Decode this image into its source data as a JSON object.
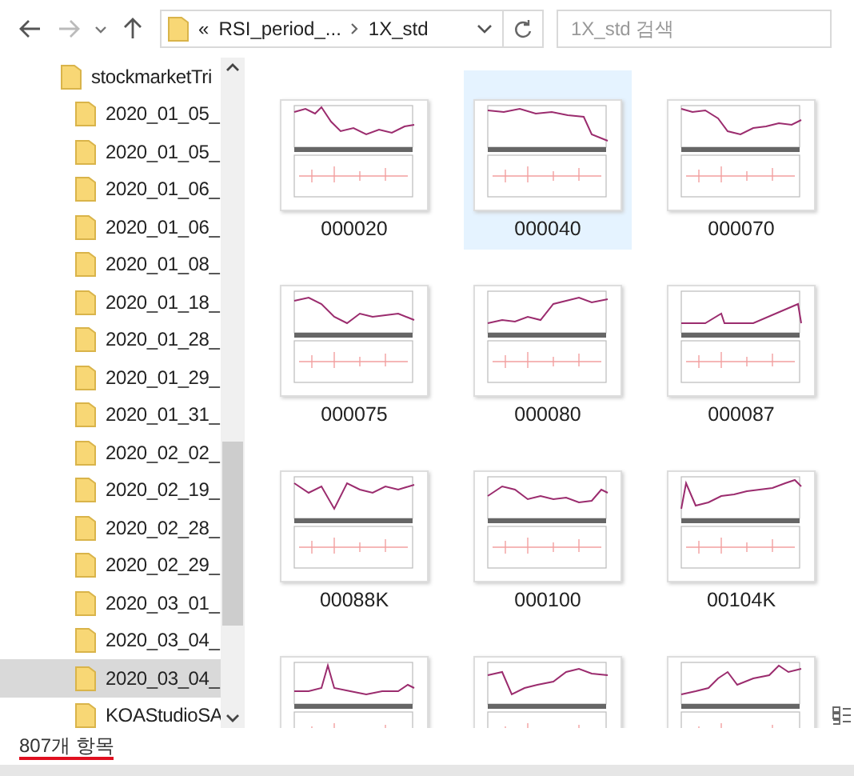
{
  "toolbar": {
    "path": [
      "RSI_period_...",
      "1X_std"
    ],
    "path_prefix": "«",
    "search": {
      "placeholder": "1X_std 검색"
    }
  },
  "navigation": {
    "items": [
      {
        "label": "stockmarketTri",
        "selected": false,
        "children": [
          {
            "label": "2020_01_05_",
            "selected": false
          },
          {
            "label": "2020_01_05_",
            "selected": false
          },
          {
            "label": "2020_01_06_",
            "selected": false
          },
          {
            "label": "2020_01_06_",
            "selected": false
          },
          {
            "label": "2020_01_08_",
            "selected": false
          },
          {
            "label": "2020_01_18_",
            "selected": false
          },
          {
            "label": "2020_01_28_",
            "selected": false
          },
          {
            "label": "2020_01_29_",
            "selected": false
          },
          {
            "label": "2020_01_31_",
            "selected": false
          },
          {
            "label": "2020_02_02_",
            "selected": false
          },
          {
            "label": "2020_02_19_",
            "selected": false
          },
          {
            "label": "2020_02_28_",
            "selected": false
          },
          {
            "label": "2020_02_29_",
            "selected": false
          },
          {
            "label": "2020_03_01_",
            "selected": false
          },
          {
            "label": "2020_03_04_",
            "selected": false
          },
          {
            "label": "2020_03_04_",
            "selected": true
          },
          {
            "label": "KOAStudioSA",
            "selected": false
          }
        ]
      }
    ]
  },
  "files": [
    {
      "label": "000020",
      "selected": false
    },
    {
      "label": "000040",
      "selected": true
    },
    {
      "label": "000070",
      "selected": false
    },
    {
      "label": "000075",
      "selected": false
    },
    {
      "label": "000080",
      "selected": false
    },
    {
      "label": "000087",
      "selected": false
    },
    {
      "label": "00088K",
      "selected": false
    },
    {
      "label": "000100",
      "selected": false
    },
    {
      "label": "00104K",
      "selected": false
    },
    {
      "selected": false
    },
    {
      "selected": false
    },
    {
      "selected": false
    }
  ],
  "status_bar": {
    "item_count": "807개 항목"
  }
}
